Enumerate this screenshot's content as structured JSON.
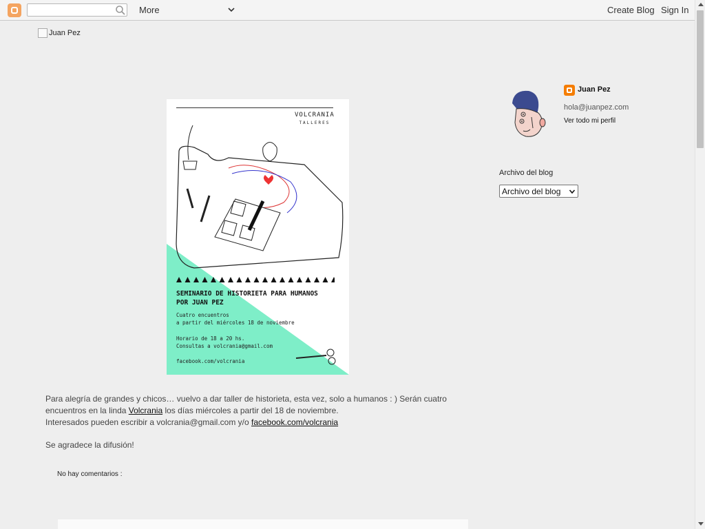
{
  "navbar": {
    "more_label": "More",
    "create_blog_label": "Create Blog",
    "sign_in_label": "Sign In",
    "search_placeholder": ""
  },
  "header": {
    "image_alt": "Juan Pez"
  },
  "poster": {
    "brand": "VOLCRANIA",
    "brand_sub": "TALLERES",
    "title_line1": "SEMINARIO DE HISTORIETA PARA HUMANOS",
    "title_line2": "POR JUAN PEZ",
    "info_line1": "Cuatro encuentros",
    "info_line2": "a partir del miércoles 18 de noviembre",
    "schedule_line1": "Horario de 18 a 20 hs.",
    "schedule_line2": "Consultas a volcrania@gmail.com",
    "facebook": "facebook.com/volcrania"
  },
  "post": {
    "p1_a": "Para alegría de grandes y chicos… vuelvo a dar taller de historieta, esta vez, solo a humanos : ) Serán cuatro",
    "p1_b_pre": "encuentros en la linda ",
    "p1_b_link": "Volcrania",
    "p1_b_post": " los días miércoles a partir del 18 de noviembre.",
    "p1_c_pre": "Interesados pueden escribir a volcrania@gmail.com y/o ",
    "p1_c_link": "facebook.com/volcrania",
    "p2": "Se agradece la difusión!",
    "comments_label": "No hay comentarios :"
  },
  "sidebar": {
    "profile_name": "Juan Pez",
    "profile_email": "hola@juanpez.com",
    "profile_link": "Ver todo mi perfil",
    "archive_title": "Archivo del blog",
    "archive_select": "Archivo del blog"
  },
  "colors": {
    "mint": "#7eeec8",
    "blogger_orange": "#f57d00",
    "background": "#eeeeee"
  }
}
